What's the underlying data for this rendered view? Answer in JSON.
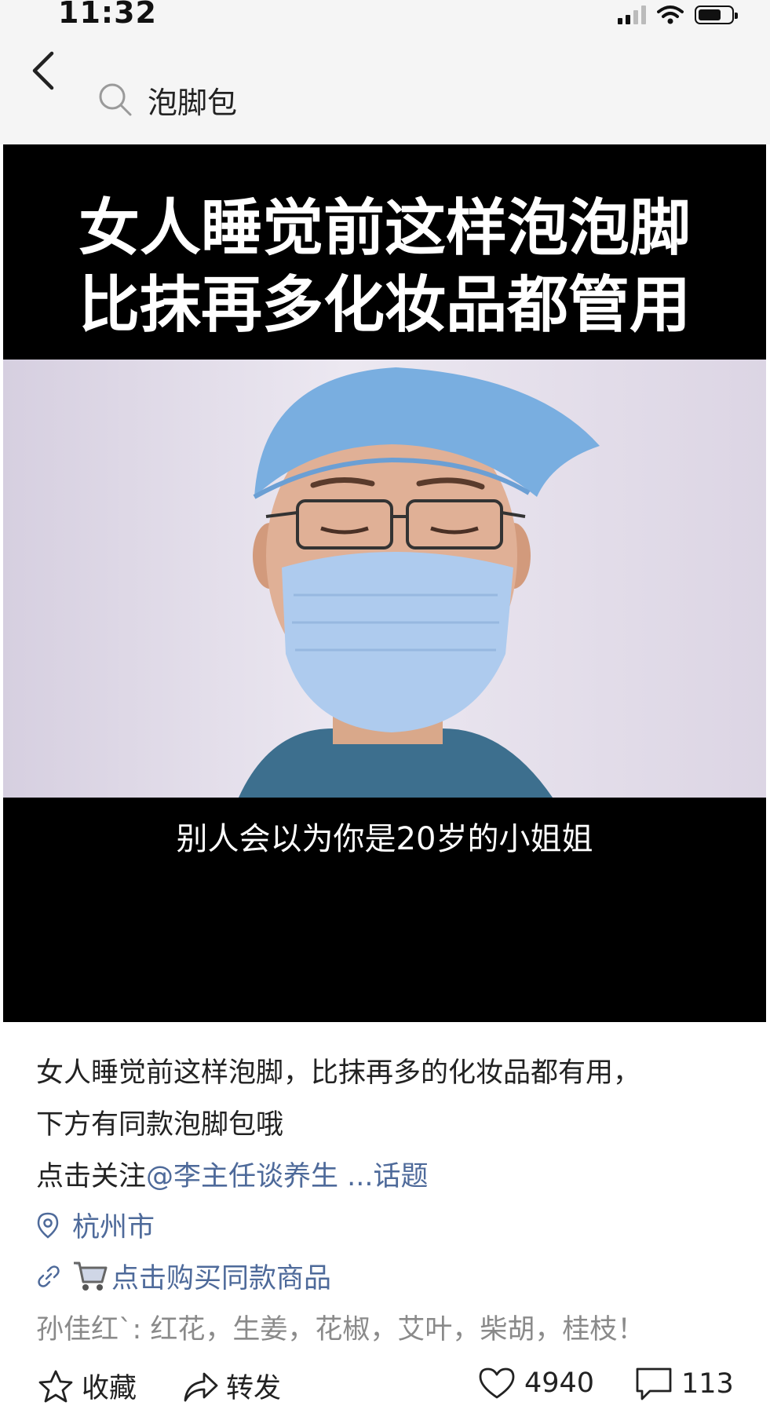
{
  "status_bar": {
    "time": "11:32"
  },
  "nav": {
    "search_query": "泡脚包"
  },
  "video": {
    "title_line1": "女人睡觉前这样泡泡脚",
    "title_line2": "比抹再多化妆品都管用",
    "subtitle": "别人会以为你是20岁的小姐姐"
  },
  "post": {
    "desc_line1": "女人睡觉前这样泡脚，比抹再多的化妆品都有用，",
    "desc_line2": "下方有同款泡脚包哦",
    "follow_prefix": "点击关注",
    "follow_account": "@李主任谈养生",
    "topic_link": " ...话题",
    "location": "杭州市",
    "product_link": "点击购买同款商品",
    "top_comment": "孙佳红`: 红花，生姜，花椒，艾叶，柴胡，桂枝！"
  },
  "actions": {
    "favorite_label": "收藏",
    "share_label": "转发",
    "like_count": "4940",
    "comment_count": "113"
  },
  "icons": [
    "back-chevron-icon",
    "search-icon",
    "location-pin-icon",
    "link-icon",
    "cart-icon",
    "star-icon",
    "share-arrow-icon",
    "heart-icon",
    "comment-icon"
  ],
  "colors": {
    "link": "#4e6a9a",
    "secondary_text": "#8a8a8a",
    "video_bg": "#000000"
  }
}
